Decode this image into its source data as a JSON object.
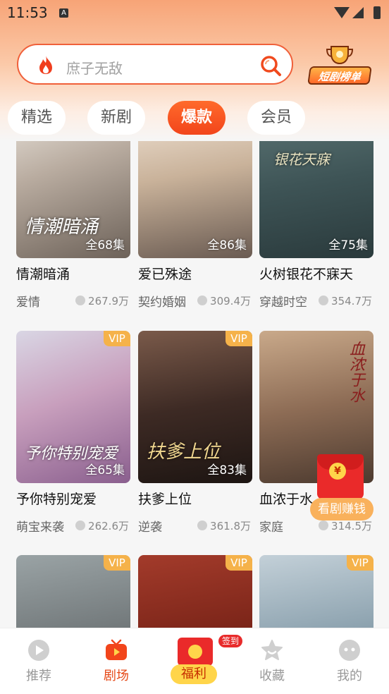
{
  "status_bar": {
    "time": "11:53",
    "notification_icon": "A"
  },
  "search": {
    "placeholder": "庶子无敌",
    "icons": [
      "fire-icon",
      "search-icon"
    ]
  },
  "rank_badge": {
    "label": "短剧榜单"
  },
  "tabs": [
    {
      "label": "精选",
      "active": false
    },
    {
      "label": "新剧",
      "active": false
    },
    {
      "label": "爆款",
      "active": true
    },
    {
      "label": "会员",
      "active": false
    }
  ],
  "dramas": [
    {
      "title": "情潮暗涌",
      "genre": "爱情",
      "views": "267.9万",
      "episodes": "全68集",
      "vip": false,
      "caption": "情潮暗涌"
    },
    {
      "title": "爱已殊途",
      "genre": "契约婚姻",
      "views": "309.4万",
      "episodes": "全86集",
      "vip": false,
      "caption": ""
    },
    {
      "title": "火树银花不寐天",
      "genre": "穿越时空",
      "views": "354.7万",
      "episodes": "全75集",
      "vip": false,
      "caption": "银花天寐"
    },
    {
      "title": "予你特别宠爱",
      "genre": "萌宝来袭",
      "views": "262.6万",
      "episodes": "全65集",
      "vip": true,
      "vip_label": "VIP",
      "caption": "予你特别宠爱"
    },
    {
      "title": "扶爹上位",
      "genre": "逆袭",
      "views": "361.8万",
      "episodes": "全83集",
      "vip": true,
      "vip_label": "VIP",
      "caption": "扶爹上位"
    },
    {
      "title": "血浓于水",
      "genre": "家庭",
      "views": "314.5万",
      "episodes": "",
      "vip": false,
      "caption": "血浓于水"
    },
    {
      "vip": true,
      "vip_label": "VIP"
    },
    {
      "vip": true,
      "vip_label": "VIP"
    },
    {
      "vip": true,
      "vip_label": "VIP"
    }
  ],
  "floating_reward": {
    "label": "看剧赚钱",
    "coin": "¥"
  },
  "bottom_nav": [
    {
      "label": "推荐",
      "icon": "play-circle-icon",
      "active": false
    },
    {
      "label": "剧场",
      "icon": "tv-icon",
      "active": true
    },
    {
      "label": "福利",
      "icon": "red-packet-icon",
      "badge": "签到"
    },
    {
      "label": "收藏",
      "icon": "star-icon",
      "active": false
    },
    {
      "label": "我的",
      "icon": "profile-icon",
      "active": false
    }
  ],
  "colors": {
    "accent": "#f2451b",
    "vip": "#f5b24a",
    "reward": "#ea2a2a"
  }
}
